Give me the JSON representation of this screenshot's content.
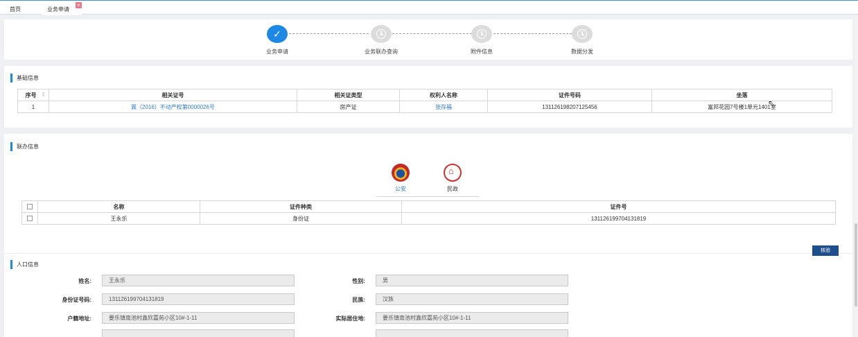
{
  "tabs": {
    "home": "首页",
    "application": "业务申请",
    "close_glyph": "×"
  },
  "steps": [
    {
      "label": "业务申请",
      "status": "done"
    },
    {
      "label": "业务联办查询",
      "status": "pending"
    },
    {
      "label": "附件信息",
      "status": "pending"
    },
    {
      "label": "数据分发",
      "status": "pending"
    }
  ],
  "basic": {
    "title": "基础信息",
    "headers": [
      "序号",
      "相关证号",
      "相关证类型",
      "权利人名称",
      "证件号码",
      "坐落"
    ],
    "row": {
      "index": "1",
      "cert_no": "冀（2016）不动产权第0000026号",
      "cert_type": "房产证",
      "owner": "张存福",
      "id_no": "131126198207125456",
      "location": "富邦花园7号楼1单元1401室"
    }
  },
  "joint": {
    "title": "联办信息",
    "agencies": [
      {
        "label": "公安",
        "icon": "police-emblem-icon",
        "active": true
      },
      {
        "label": "民政",
        "icon": "civil-affairs-emblem-icon",
        "active": false
      }
    ],
    "headers": [
      "名称",
      "证件种类",
      "证件号"
    ],
    "row": {
      "name": "王永乐",
      "id_type": "身份证",
      "id_no": "131126199704131819"
    },
    "verify_label": "核验"
  },
  "population": {
    "title": "人口信息",
    "fields": {
      "name_label": "姓名:",
      "name_value": "王永乐",
      "gender_label": "性别:",
      "gender_value": "男",
      "id_label": "身份证号码:",
      "id_value": "131126199704131819",
      "ethnic_label": "民族:",
      "ethnic_value": "汉族",
      "household_label": "户籍地址:",
      "household_value": "要乐镇南池村鑫欣嘉苑小区10#-1-11",
      "residence_label": "实际居住地:",
      "residence_value": "要乐镇南池村鑫欣嘉苑小区10#-1-11"
    }
  },
  "colors": {
    "accent": "#1e88e5",
    "button": "#1f4e8c",
    "link": "#2d7bd1"
  }
}
